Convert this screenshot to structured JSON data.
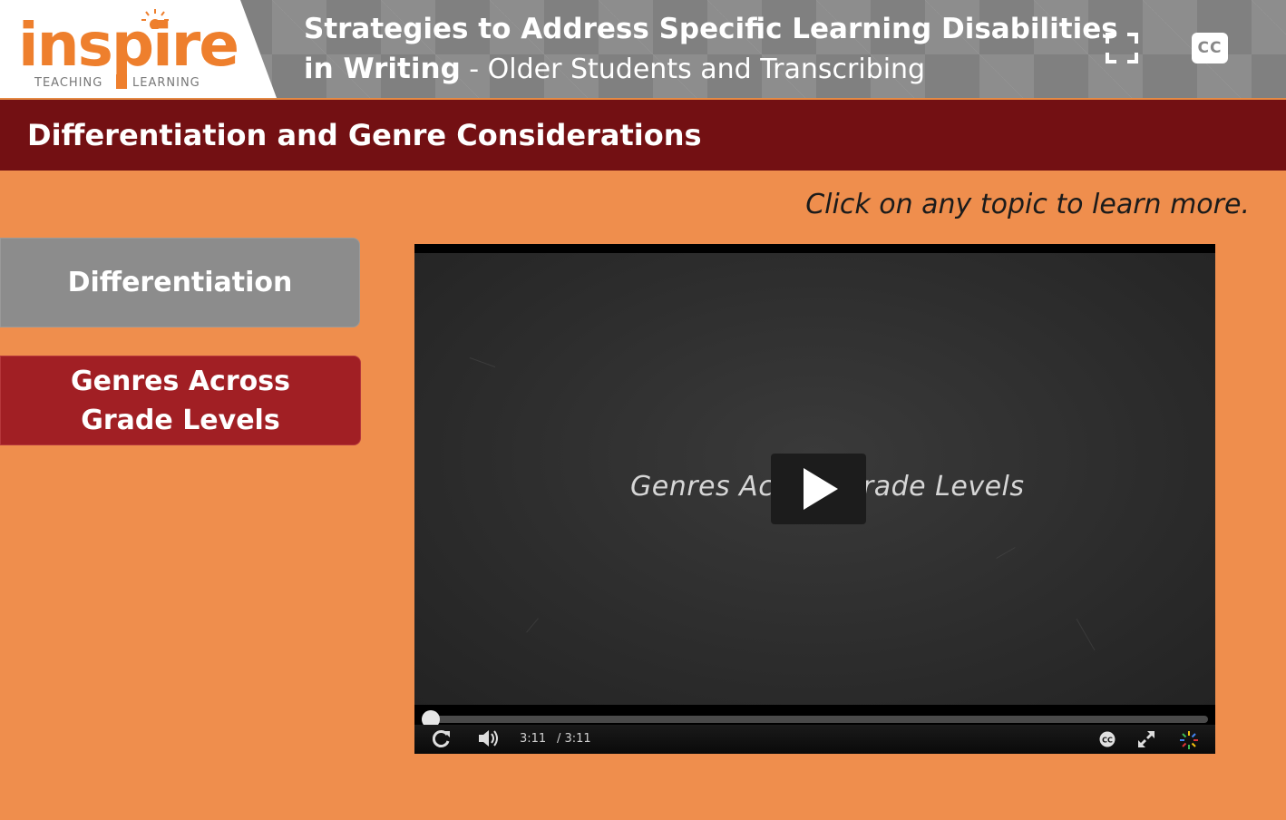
{
  "header": {
    "logo": {
      "word": "inspire",
      "sub_left": "TEACHING",
      "sub_right": "LEARNING"
    },
    "title_line1": "Strategies to Address Specific Learning Disabilities",
    "title_line2_bold": "in Writing",
    "title_line2_rest": " - Older Students and Transcribing",
    "fullscreen_icon": "fullscreen-icon",
    "cc_label": "CC"
  },
  "section": {
    "title": "Differentiation and Genre Considerations"
  },
  "instruction": "Click on any topic to learn more.",
  "topics": [
    {
      "label": "Differentiation",
      "state": "inactive"
    },
    {
      "label_line1": "Genres Across",
      "label_line2": "Grade Levels",
      "state": "active"
    }
  ],
  "video": {
    "overlay_text": "Genres Across Grade Levels",
    "current_time": "3:11",
    "duration": "/ 3:11",
    "progress_fraction": 0,
    "controls": [
      "replay-icon",
      "volume-icon",
      "cc-icon",
      "expand-icon",
      "loading-icon"
    ]
  },
  "colors": {
    "background": "#ef8e4d",
    "section_bar": "#731013",
    "active_topic": "#a11f24",
    "inactive_topic": "#8c8c8c",
    "brand_orange": "#ee7f2d"
  }
}
